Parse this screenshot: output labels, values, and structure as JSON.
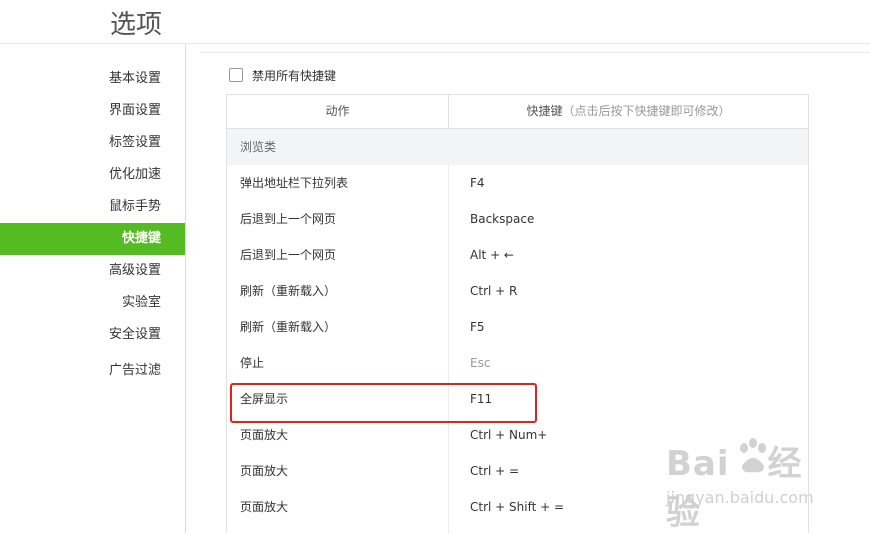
{
  "page": {
    "title": "选项"
  },
  "sidebar": {
    "items": [
      {
        "label": "基本设置",
        "active": false
      },
      {
        "label": "界面设置",
        "active": false
      },
      {
        "label": "标签设置",
        "active": false
      },
      {
        "label": "优化加速",
        "active": false
      },
      {
        "label": "鼠标手势",
        "active": false
      },
      {
        "label": "快捷键",
        "active": true
      },
      {
        "label": "高级设置",
        "active": false
      },
      {
        "label": "实验室",
        "active": false
      },
      {
        "label": "安全设置",
        "active": false
      },
      {
        "label": "广告过滤",
        "active": false
      }
    ],
    "active_color": "#55bb22"
  },
  "disable_all": {
    "label": "禁用所有快捷键",
    "checked": false
  },
  "table": {
    "col_action": "动作",
    "col_shortcut": "快捷键",
    "col_shortcut_hint": "（点击后按下快捷键即可修改）",
    "group": "浏览类",
    "rows": [
      {
        "action": "弹出地址栏下拉列表",
        "key": "F4"
      },
      {
        "action": "后退到上一个网页",
        "key": "Backspace"
      },
      {
        "action": "后退到上一个网页",
        "key": "Alt + ←"
      },
      {
        "action": "刷新（重新载入）",
        "key": "Ctrl + R"
      },
      {
        "action": "刷新（重新载入）",
        "key": "F5"
      },
      {
        "action": "停止",
        "key": "Esc",
        "muted": true
      },
      {
        "action": "全屏显示",
        "key": "F11",
        "highlighted": true
      },
      {
        "action": "页面放大",
        "key": "Ctrl + Num+"
      },
      {
        "action": "页面放大",
        "key": "Ctrl + ="
      },
      {
        "action": "页面放大",
        "key": "Ctrl + Shift + ="
      }
    ]
  },
  "highlight_color": "#e0241a",
  "watermark": {
    "logo_a": "Bai",
    "logo_b": "经验",
    "url": "jingyan.baidu.com"
  }
}
